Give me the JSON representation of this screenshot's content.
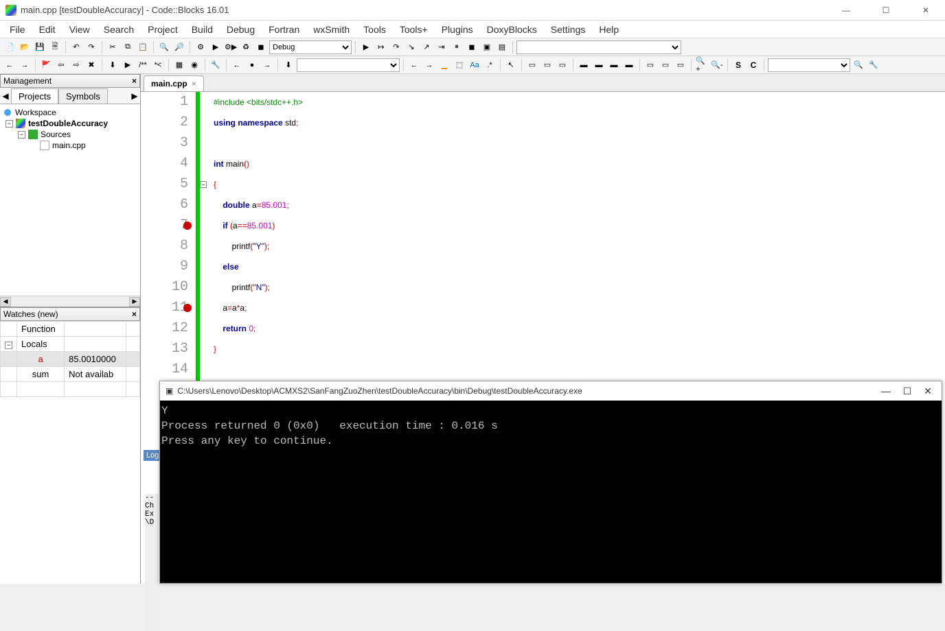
{
  "window": {
    "title": "main.cpp [testDoubleAccuracy] - Code::Blocks 16.01"
  },
  "menu": [
    "File",
    "Edit",
    "View",
    "Search",
    "Project",
    "Build",
    "Debug",
    "Fortran",
    "wxSmith",
    "Tools",
    "Tools+",
    "Plugins",
    "DoxyBlocks",
    "Settings",
    "Help"
  ],
  "toolbar1_combo": "Debug",
  "management": {
    "title": "Management",
    "tabs": [
      "Projects",
      "Symbols"
    ],
    "tree": {
      "workspace": "Workspace",
      "project": "testDoubleAccuracy",
      "sources": "Sources",
      "file": "main.cpp"
    }
  },
  "watches": {
    "title": "Watches (new)",
    "rows": [
      {
        "name": "Function",
        "value": ""
      },
      {
        "name": "Locals",
        "value": ""
      },
      {
        "name": "a",
        "value": "85.0010000"
      },
      {
        "name": "sum",
        "value": "Not availab"
      }
    ]
  },
  "editor": {
    "tab_name": "main.cpp",
    "breakpoints": [
      7,
      11
    ],
    "lines": [
      {
        "n": 1,
        "tokens": [
          {
            "t": "#include ",
            "c": "pp"
          },
          {
            "t": "<bits/stdc++.h>",
            "c": "ppinc"
          }
        ]
      },
      {
        "n": 2,
        "tokens": [
          {
            "t": "using ",
            "c": "kw"
          },
          {
            "t": "namespace ",
            "c": "kw"
          },
          {
            "t": "std",
            "c": "id"
          },
          {
            "t": ";",
            "c": "punc"
          }
        ]
      },
      {
        "n": 3,
        "tokens": []
      },
      {
        "n": 4,
        "tokens": [
          {
            "t": "int ",
            "c": "kw"
          },
          {
            "t": "main",
            "c": "fn"
          },
          {
            "t": "()",
            "c": "punc"
          }
        ]
      },
      {
        "n": 5,
        "tokens": [
          {
            "t": "{",
            "c": "brace"
          }
        ]
      },
      {
        "n": 6,
        "tokens": [
          {
            "t": "    ",
            "c": ""
          },
          {
            "t": "double ",
            "c": "kw"
          },
          {
            "t": "a",
            "c": "id"
          },
          {
            "t": "=",
            "c": "punc"
          },
          {
            "t": "85.001",
            "c": "num"
          },
          {
            "t": ";",
            "c": "punc"
          }
        ]
      },
      {
        "n": 7,
        "tokens": [
          {
            "t": "    ",
            "c": ""
          },
          {
            "t": "if ",
            "c": "kw"
          },
          {
            "t": "(",
            "c": "punc"
          },
          {
            "t": "a",
            "c": "id"
          },
          {
            "t": "==",
            "c": "punc"
          },
          {
            "t": "85.001",
            "c": "num"
          },
          {
            "t": ")",
            "c": "punc"
          }
        ]
      },
      {
        "n": 8,
        "tokens": [
          {
            "t": "        printf",
            "c": "id"
          },
          {
            "t": "(",
            "c": "punc"
          },
          {
            "t": "\"Y\"",
            "c": "str"
          },
          {
            "t": ")",
            "c": "punc"
          },
          {
            "t": ";",
            "c": "punc"
          }
        ]
      },
      {
        "n": 9,
        "tokens": [
          {
            "t": "    ",
            "c": ""
          },
          {
            "t": "else",
            "c": "kw"
          }
        ]
      },
      {
        "n": 10,
        "tokens": [
          {
            "t": "        printf",
            "c": "id"
          },
          {
            "t": "(",
            "c": "punc"
          },
          {
            "t": "\"N\"",
            "c": "str"
          },
          {
            "t": ")",
            "c": "punc"
          },
          {
            "t": ";",
            "c": "punc"
          }
        ]
      },
      {
        "n": 11,
        "tokens": [
          {
            "t": "    a",
            "c": "id"
          },
          {
            "t": "=",
            "c": "punc"
          },
          {
            "t": "a",
            "c": "id"
          },
          {
            "t": "*",
            "c": "op-star"
          },
          {
            "t": "a",
            "c": "id"
          },
          {
            "t": ";",
            "c": "punc"
          }
        ]
      },
      {
        "n": 12,
        "tokens": [
          {
            "t": "    ",
            "c": ""
          },
          {
            "t": "return ",
            "c": "kw"
          },
          {
            "t": "0",
            "c": "num"
          },
          {
            "t": ";",
            "c": "punc"
          }
        ]
      },
      {
        "n": 13,
        "tokens": [
          {
            "t": "}",
            "c": "brace"
          }
        ]
      },
      {
        "n": 14,
        "tokens": []
      }
    ]
  },
  "console": {
    "path": "C:\\Users\\Lenovo\\Desktop\\ACMXS2\\SanFangZuoZhen\\testDoubleAccuracy\\bin\\Debug\\testDoubleAccuracy.exe",
    "output": "Y\nProcess returned 0 (0x0)   execution time : 0.016 s\nPress any key to continue."
  },
  "log_strip": {
    "tab": "Log",
    "lines": "--\nCh\nEx\n\\D"
  }
}
